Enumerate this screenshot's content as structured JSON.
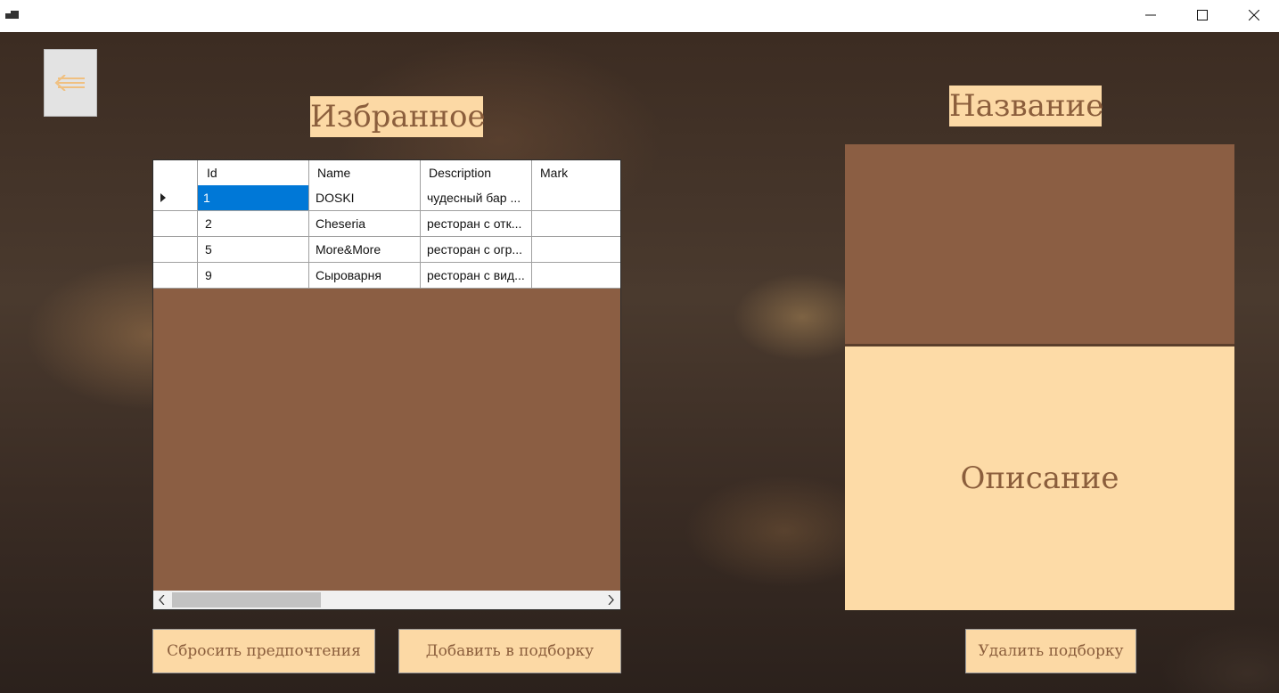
{
  "window": {
    "controls": {
      "minimize_icon": "minimize-icon",
      "maximize_icon": "maximize-icon",
      "close_icon": "close-icon"
    }
  },
  "back_button": {
    "icon": "arrow-left-icon",
    "color": "#f0c080"
  },
  "favorites": {
    "title": "Избранное",
    "columns": [
      "Id",
      "Name",
      "Description",
      "Mark"
    ],
    "rows": [
      {
        "id": "1",
        "name": "DOSKI",
        "description": "чудесный бар ...",
        "mark": "",
        "selected": true
      },
      {
        "id": "2",
        "name": "Cheseria",
        "description": "ресторан с отк...",
        "mark": ""
      },
      {
        "id": "5",
        "name": "More&More",
        "description": "ресторан с огр...",
        "mark": ""
      },
      {
        "id": "9",
        "name": "Сыроварня",
        "description": "ресторан с вид...",
        "mark": ""
      }
    ]
  },
  "detail": {
    "title": "Название",
    "description": "Описание"
  },
  "buttons": {
    "reset": "Сбросить предпочтения",
    "add": "Добавить в подборку",
    "delete": "Удалить подборку"
  },
  "colors": {
    "accent": "#fcd9a5",
    "text_brown": "#8b5e3c",
    "panel_brown": "#8b5e43",
    "selection": "#0078d7"
  }
}
